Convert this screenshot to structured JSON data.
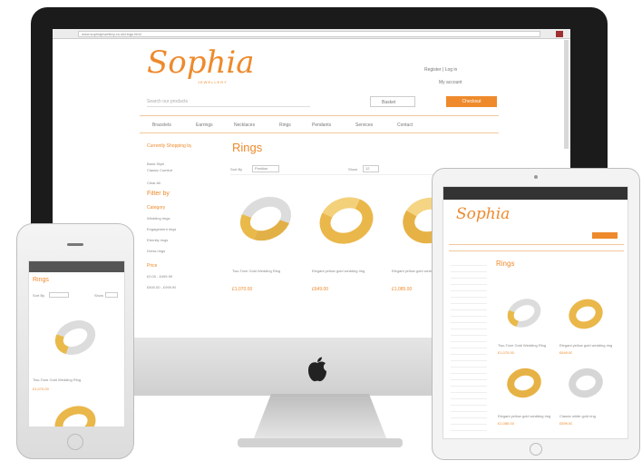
{
  "desktop": {
    "url": "www.sophiajewellery.co.uk/rings.html",
    "logo": "Sophia",
    "logo_sub": "JEWELLERY",
    "account": "Register | Log in",
    "basket": "My account",
    "search_placeholder": "Search our products",
    "basket_label": "Basket",
    "checkout": "Checkout",
    "nav": [
      "Bracelets",
      "Earrings",
      "Necklaces",
      "Rings",
      "Pendants",
      "Services",
      "Contact"
    ],
    "sidebar": {
      "shopping_title": "Currently Shopping by",
      "shopping_text": "Band Style",
      "shopping_text2": "Classic Comfort",
      "clear_all": "Clear All",
      "filter_title": "Filter by",
      "category_title": "Category",
      "categories": [
        "Wedding rings",
        "Engagement rings",
        "Eternity rings",
        "Dress rings"
      ],
      "price_title": "Price",
      "prices": [
        "£0.00 - £499.99",
        "£500.00 - £999.99"
      ]
    },
    "page_title": "Rings",
    "sort_label": "Sort By",
    "sort_value": "Position",
    "show_label": "Show",
    "show_value": "12",
    "products": [
      {
        "name": "Two-Tone Gold Wedding Ring",
        "price": "£1,070.00"
      },
      {
        "name": "Elegant yellow gold wedding ring",
        "price": "£649.00"
      },
      {
        "name": "Elegant yellow gold wedding ring",
        "price": "£1,085.00"
      }
    ]
  },
  "phone": {
    "page_title": "Rings",
    "sort_label": "Sort By",
    "show_label": "Show",
    "product_name": "Two-Tone Gold Wedding Ring",
    "product_price": "£1,070.00"
  },
  "tablet": {
    "logo": "Sophia",
    "page_title": "Rings",
    "products": [
      {
        "name": "Two-Tone Gold Wedding Ring",
        "price": "£1,070.00"
      },
      {
        "name": "Elegant yellow gold wedding ring",
        "price": "£649.00"
      },
      {
        "name": "Elegant yellow gold wedding ring",
        "price": "£1,085.00"
      },
      {
        "name": "Classic white gold ring",
        "price": "£599.00"
      }
    ]
  },
  "colors": {
    "accent": "#ee8a2c",
    "gold": "#e9b94a",
    "silver": "#cfcfcf"
  }
}
